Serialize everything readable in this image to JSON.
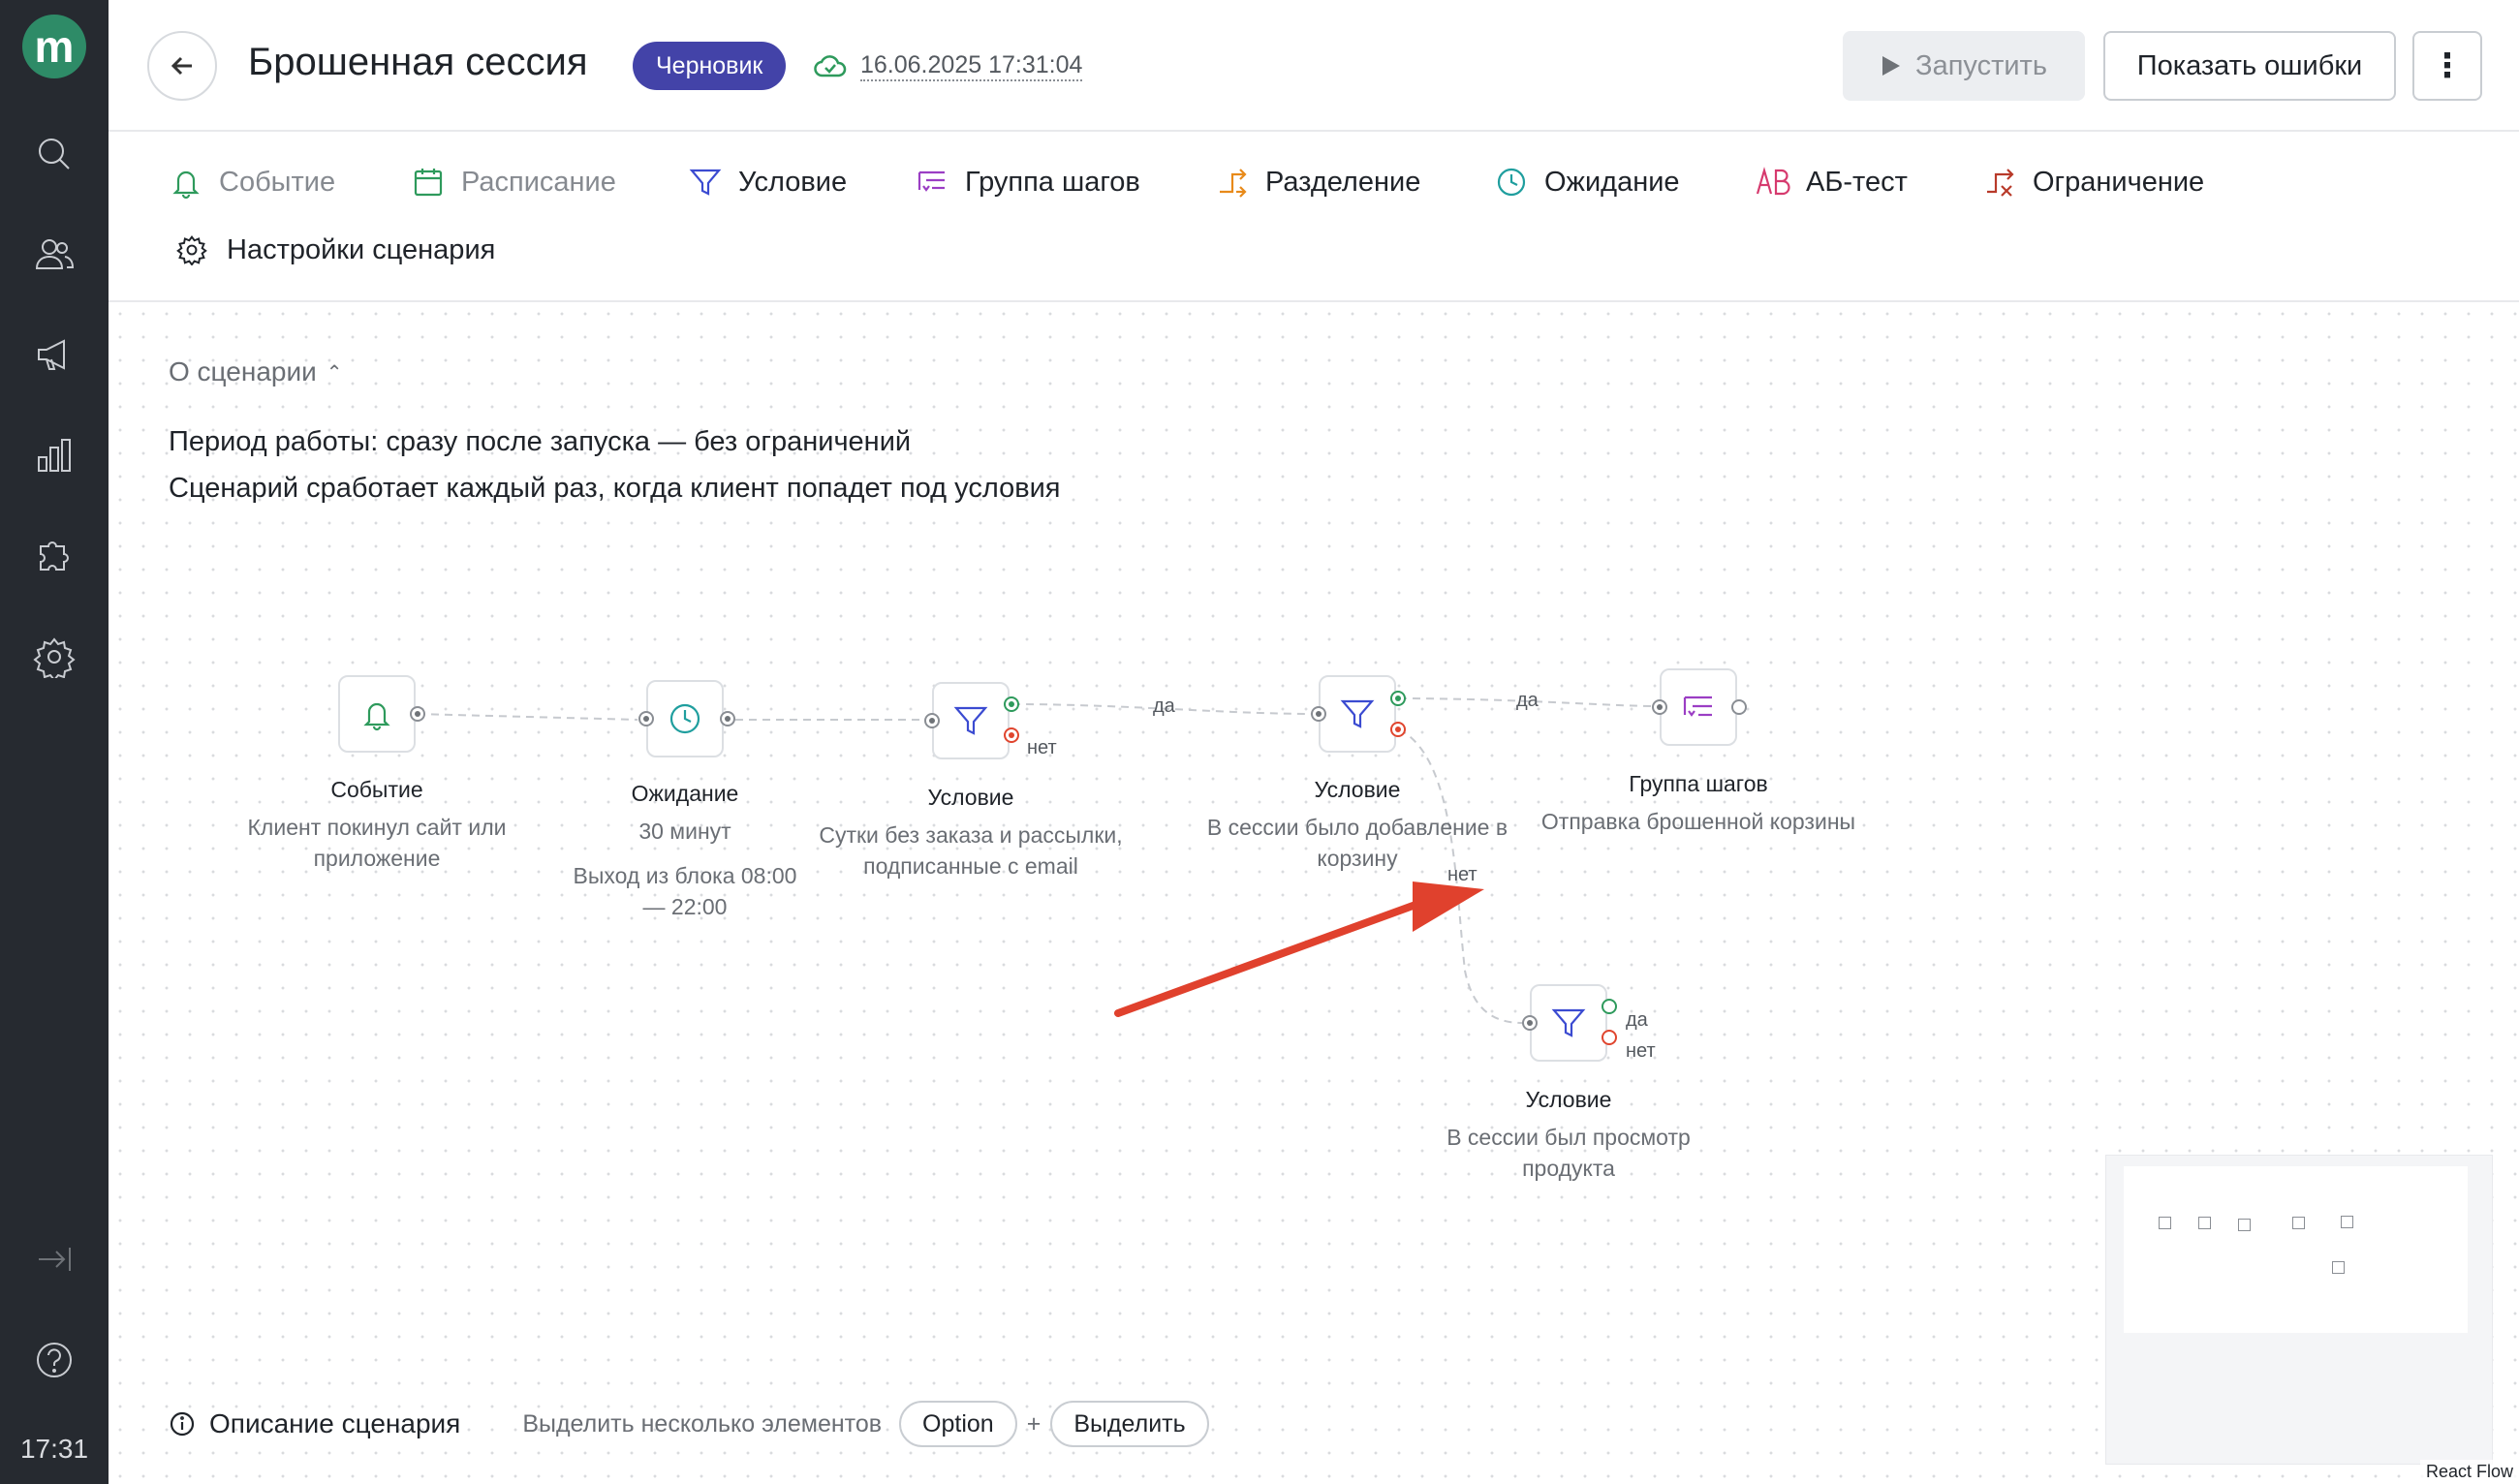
{
  "sidebar": {
    "logo": "m",
    "icons": [
      "search-icon",
      "users-icon",
      "megaphone-icon",
      "analytics-icon",
      "integrations-icon",
      "settings-icon",
      "collapse-icon",
      "help-icon"
    ],
    "time": "17:31"
  },
  "header": {
    "title": "Брошенная сессия",
    "status": "Черновик",
    "saved_at": "16.06.2025 17:31:04",
    "run_label": "Запустить",
    "errors_label": "Показать ошибки"
  },
  "toolbar": {
    "items": [
      {
        "label": "Событие",
        "icon": "bell-icon",
        "color": "#2e9a5c"
      },
      {
        "label": "Расписание",
        "icon": "calendar-icon",
        "color": "#2e9a5c"
      },
      {
        "label": "Условие",
        "icon": "filter-icon",
        "color": "#3b4bd1"
      },
      {
        "label": "Группа шагов",
        "icon": "step-group-icon",
        "color": "#9b3ec4"
      },
      {
        "label": "Разделение",
        "icon": "split-icon",
        "color": "#e88a1a"
      },
      {
        "label": "Ожидание",
        "icon": "clock-icon",
        "color": "#1f9e9e"
      },
      {
        "label": "АБ-тест",
        "icon": "ab-test-icon",
        "color": "#d63a6e"
      },
      {
        "label": "Ограничение",
        "icon": "limit-icon",
        "color": "#b83a2a"
      }
    ],
    "settings_label": "Настройки сценария"
  },
  "about": {
    "toggle_label": "О сценарии",
    "period": "Период работы: сразу после запуска — без ограничений",
    "trigger": "Сценарий сработает каждый раз, когда клиент попадет под условия"
  },
  "flow": {
    "nodes": [
      {
        "title": "Событие",
        "description": "Клиент покинул сайт или приложение"
      },
      {
        "title": "Ожидание",
        "description": "30 минут",
        "extra": "Выход из блока 08:00 — 22:00"
      },
      {
        "title": "Условие",
        "description": "Сутки без заказа и рассылки, подписанные с email"
      },
      {
        "title": "Условие",
        "description": "В сессии было добавление в корзину"
      },
      {
        "title": "Группа шагов",
        "description": "Отправка брошенной корзины"
      },
      {
        "title": "Условие",
        "description": "В сессии был просмотр продукта"
      }
    ],
    "labels": {
      "yes": "да",
      "no": "нет"
    }
  },
  "bottom": {
    "description_label": "Описание сценария",
    "hint": "Выделить несколько элементов",
    "key1": "Option",
    "plus": "+",
    "key2": "Выделить"
  },
  "minimap": {
    "attribution": "React Flow"
  },
  "colors": {
    "accent": "#4343a8",
    "sidebar": "#262a30",
    "yes": "#2e9a5c",
    "no": "#e0452e",
    "arrow": "#e0412d"
  }
}
